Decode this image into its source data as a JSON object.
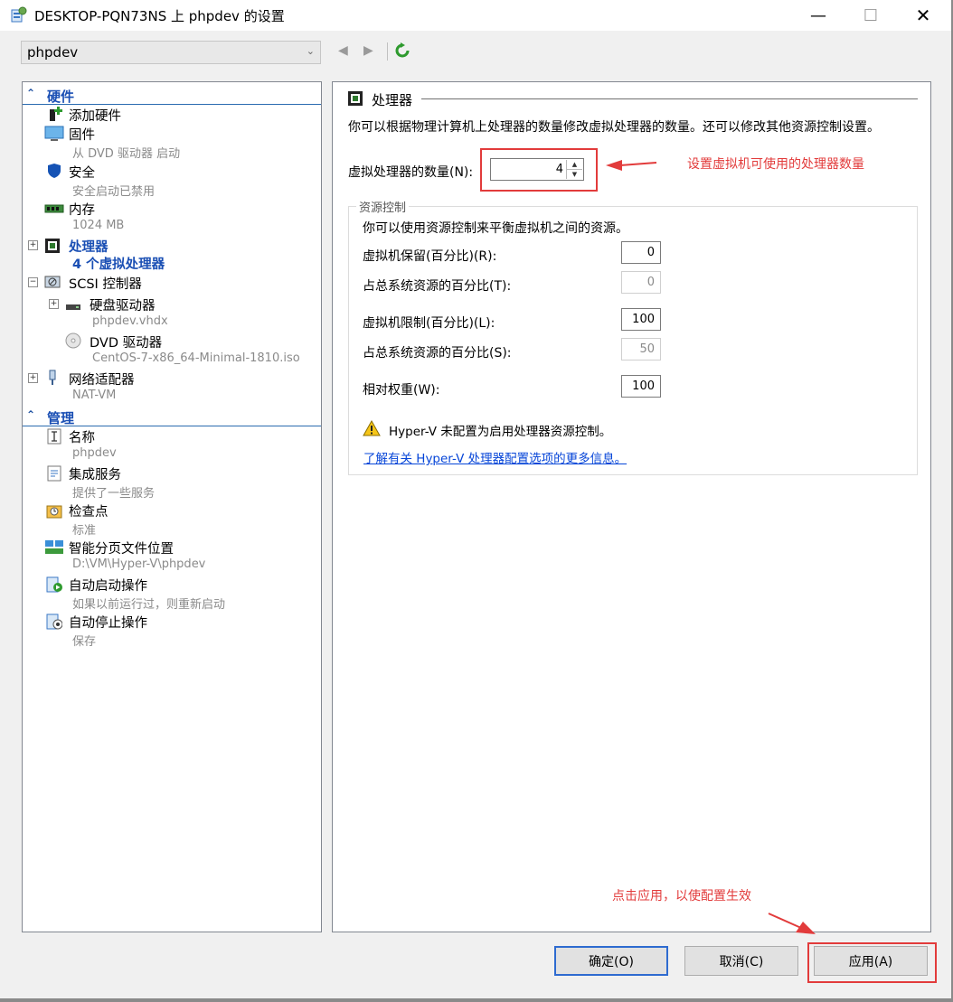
{
  "window": {
    "title": "DESKTOP-PQN73NS 上 phpdev 的设置",
    "minimize": "—",
    "maximize": "☐",
    "close": "✕"
  },
  "toolbar": {
    "vm_selected": "phpdev"
  },
  "tree": {
    "hardware_header": "硬件",
    "management_header": "管理",
    "hardware": [
      {
        "label": "添加硬件",
        "sub": ""
      },
      {
        "label": "固件",
        "sub": "从 DVD 驱动器 启动"
      },
      {
        "label": "安全",
        "sub": "安全启动已禁用"
      },
      {
        "label": "内存",
        "sub": "1024 MB"
      },
      {
        "label": "处理器",
        "sub": "4 个虚拟处理器"
      },
      {
        "label": "SCSI 控制器",
        "sub": ""
      },
      {
        "label": "硬盘驱动器",
        "sub": "phpdev.vhdx"
      },
      {
        "label": "DVD 驱动器",
        "sub": "CentOS-7-x86_64-Minimal-1810.iso"
      },
      {
        "label": "网络适配器",
        "sub": "NAT-VM"
      }
    ],
    "management": [
      {
        "label": "名称",
        "sub": "phpdev"
      },
      {
        "label": "集成服务",
        "sub": "提供了一些服务"
      },
      {
        "label": "检查点",
        "sub": "标准"
      },
      {
        "label": "智能分页文件位置",
        "sub": "D:\\VM\\Hyper-V\\phpdev"
      },
      {
        "label": "自动启动操作",
        "sub": "如果以前运行过，则重新启动"
      },
      {
        "label": "自动停止操作",
        "sub": "保存"
      }
    ]
  },
  "processor": {
    "title": "处理器",
    "description": "你可以根据物理计算机上处理器的数量修改虚拟处理器的数量。还可以修改其他资源控制设置。",
    "count_label": "虚拟处理器的数量(N):",
    "count_value": "4",
    "resource_group_title": "资源控制",
    "resource_desc": "你可以使用资源控制来平衡虚拟机之间的资源。",
    "reserve_label": "虚拟机保留(百分比)(R):",
    "reserve_value": "0",
    "reserve_total_label": "占总系统资源的百分比(T):",
    "reserve_total_value": "0",
    "limit_label": "虚拟机限制(百分比)(L):",
    "limit_value": "100",
    "limit_total_label": "占总系统资源的百分比(S):",
    "limit_total_value": "50",
    "weight_label": "相对权重(W):",
    "weight_value": "100",
    "warning": "Hyper-V 未配置为启用处理器资源控制。",
    "link": "了解有关 Hyper-V 处理器配置选项的更多信息。"
  },
  "annotations": {
    "set_count": "设置虚拟机可使用的处理器数量",
    "apply_hint": "点击应用，以使配置生效"
  },
  "buttons": {
    "ok": "确定(O)",
    "cancel": "取消(C)",
    "apply": "应用(A)"
  },
  "colors": {
    "accent": "#1a4fb4",
    "annotation": "#e23b3b",
    "default_button_border": "#2e6bd0"
  }
}
